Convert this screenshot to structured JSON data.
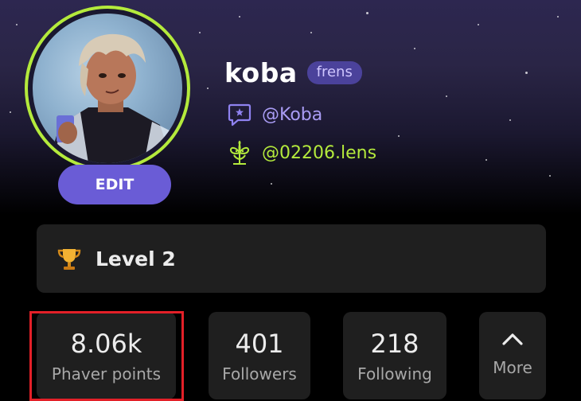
{
  "profile": {
    "name": "koba",
    "badge": "frens",
    "handle_phaver": "@Koba",
    "handle_lens": "@02206.lens",
    "edit_label": "EDIT"
  },
  "level": {
    "label": "Level 2",
    "icon": "trophy-icon"
  },
  "stats": [
    {
      "value": "8.06k",
      "label": "Phaver points"
    },
    {
      "value": "401",
      "label": "Followers"
    },
    {
      "value": "218",
      "label": "Following"
    }
  ],
  "more_label": "More",
  "colors": {
    "accent_green": "#b4ea3c",
    "accent_purple": "#6a5cd6",
    "badge_bg": "#4b429b",
    "handle_purple": "#a99cf4",
    "card_bg": "#1f1f1f",
    "highlight_red": "#e32028"
  }
}
